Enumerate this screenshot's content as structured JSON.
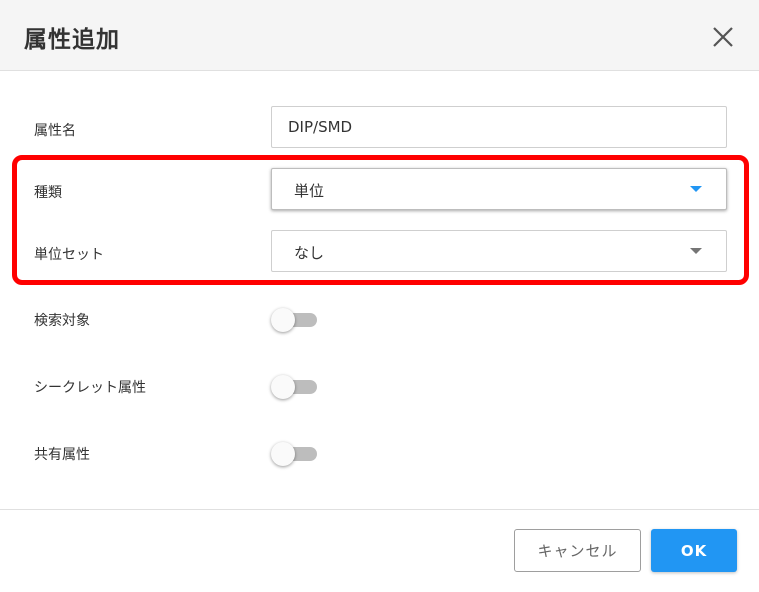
{
  "dialog": {
    "title": "属性追加",
    "close_icon": "close-icon"
  },
  "form": {
    "attribute_name": {
      "label": "属性名",
      "value": "DIP/SMD"
    },
    "type": {
      "label": "種類",
      "value": "単位"
    },
    "unit_set": {
      "label": "単位セット",
      "value": "なし"
    },
    "searchable": {
      "label": "検索対象",
      "on": false
    },
    "secret": {
      "label": "シークレット属性",
      "on": false
    },
    "shared": {
      "label": "共有属性",
      "on": false
    }
  },
  "footer": {
    "cancel_label": "キャンセル",
    "ok_label": "OK"
  },
  "colors": {
    "accent": "#2196f3",
    "highlight": "#ff0000",
    "header_bg": "#f5f5f5"
  }
}
